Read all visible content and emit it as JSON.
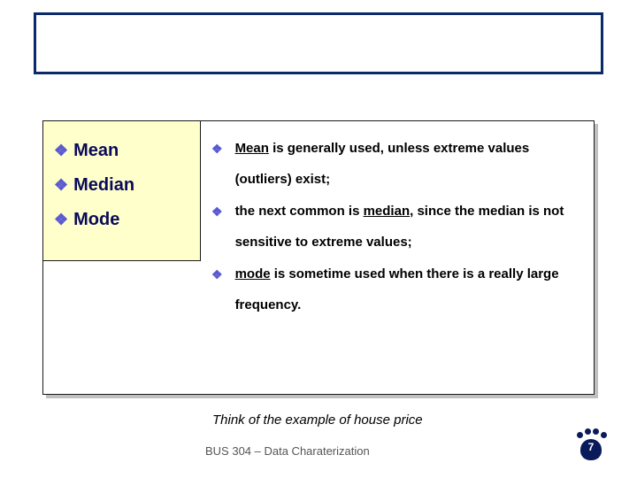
{
  "left": {
    "item1": "Mean",
    "item2": "Median",
    "item3": "Mode"
  },
  "right": {
    "p1a": "Mean",
    "p1b": " is generally used, unless extreme values (outliers) exist;",
    "p2a": "the next common is ",
    "p2b": "median",
    "p2c": ", since the median is not sensitive to extreme values;",
    "p3a": " ",
    "p3b": "mode",
    "p3c": " is sometime used when there is a really large frequency."
  },
  "think": "Think of the example of house price",
  "footer": "BUS 304 – Data Charaterization",
  "page": "7"
}
